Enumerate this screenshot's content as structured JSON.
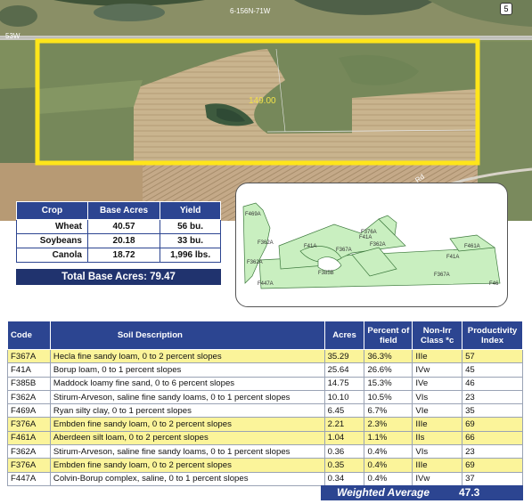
{
  "aerial": {
    "road_top_label": "6-156N-71W",
    "road_left_label": "53W",
    "field_acres_label": "149.00",
    "section_badge": "5",
    "road_lower_label": "Rd"
  },
  "crop_table": {
    "headers": [
      "Crop",
      "Base Acres",
      "Yield"
    ],
    "rows": [
      {
        "crop": "Wheat",
        "base_acres": "40.57",
        "yield": "56 bu."
      },
      {
        "crop": "Soybeans",
        "base_acres": "20.18",
        "yield": "33 bu."
      },
      {
        "crop": "Canola",
        "base_acres": "18.72",
        "yield": "1,996 lbs."
      }
    ],
    "total_label": "Total Base Acres:",
    "total_value": "79.47"
  },
  "soil_map": {
    "labels": [
      "F469A",
      "F362A",
      "F362A",
      "F41A",
      "F367A",
      "F447A",
      "F41A",
      "F362A",
      "F376A",
      "F385B",
      "F461A",
      "F41A",
      "F367A",
      "F46"
    ]
  },
  "soil_table": {
    "headers": {
      "code": "Code",
      "description": "Soil Description",
      "acres": "Acres",
      "percent": "Percent of field",
      "class": "Non-Irr Class *c",
      "productivity": "Productivity Index"
    },
    "rows": [
      {
        "code": "F367A",
        "description": "Hecla fine sandy loam, 0 to 2 percent slopes",
        "acres": "35.29",
        "percent": "36.3%",
        "class": "IIIe",
        "pi": "57",
        "highlight": true
      },
      {
        "code": "F41A",
        "description": "Borup loam, 0 to 1 percent slopes",
        "acres": "25.64",
        "percent": "26.6%",
        "class": "IVw",
        "pi": "45",
        "highlight": false
      },
      {
        "code": "F385B",
        "description": "Maddock loamy fine sand, 0 to 6 percent slopes",
        "acres": "14.75",
        "percent": "15.3%",
        "class": "IVe",
        "pi": "46",
        "highlight": false
      },
      {
        "code": "F362A",
        "description": "Stirum-Arveson, saline fine sandy loams, 0 to 1 percent slopes",
        "acres": "10.10",
        "percent": "10.5%",
        "class": "VIs",
        "pi": "23",
        "highlight": false
      },
      {
        "code": "F469A",
        "description": "Ryan silty clay, 0 to 1 percent slopes",
        "acres": "6.45",
        "percent": "6.7%",
        "class": "VIe",
        "pi": "35",
        "highlight": false
      },
      {
        "code": "F376A",
        "description": "Embden fine sandy loam, 0 to 2 percent slopes",
        "acres": "2.21",
        "percent": "2.3%",
        "class": "IIIe",
        "pi": "69",
        "highlight": true
      },
      {
        "code": "F461A",
        "description": "Aberdeen silt loam, 0 to 2 percent slopes",
        "acres": "1.04",
        "percent": "1.1%",
        "class": "IIs",
        "pi": "66",
        "highlight": true
      },
      {
        "code": "F362A",
        "description": "Stirum-Arveson, saline fine sandy loams, 0 to 1 percent slopes",
        "acres": "0.36",
        "percent": "0.4%",
        "class": "VIs",
        "pi": "23",
        "highlight": false
      },
      {
        "code": "F376A",
        "description": "Embden fine sandy loam, 0 to 2 percent slopes",
        "acres": "0.35",
        "percent": "0.4%",
        "class": "IIIe",
        "pi": "69",
        "highlight": true
      },
      {
        "code": "F447A",
        "description": "Colvin-Borup complex, saline, 0 to 1 percent slopes",
        "acres": "0.34",
        "percent": "0.4%",
        "class": "IVw",
        "pi": "37",
        "highlight": false
      }
    ],
    "weighted_average_label": "Weighted Average",
    "weighted_average_value": "47.3"
  },
  "colors": {
    "header_blue": "#2c4591",
    "highlight_yellow": "#fbf49a",
    "field_outline": "#ffe51a",
    "soil_fill": "#c9efc0"
  }
}
